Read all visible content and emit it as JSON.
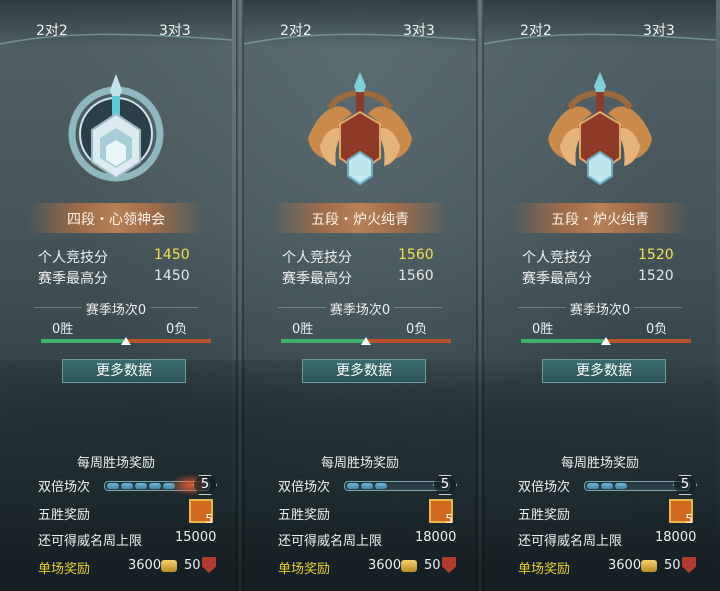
{
  "panels": [
    {
      "tabs": [
        "2对2",
        "3对3"
      ],
      "rank_name": "四段・心领神会",
      "emblem": "silver-blue-emblem",
      "personal_score_label": "个人竞技分",
      "personal_score": "1450",
      "season_high_label": "赛季最高分",
      "season_high": "1450",
      "season_matches": "赛季场次0",
      "wins": "0胜",
      "losses": "0负",
      "more_data": "更多数据",
      "weekly_reward": "每周胜场奖励",
      "double_label": "双倍场次",
      "double_count": "5",
      "five_win_label": "五胜奖励",
      "five_win_count": "5",
      "cap_label": "还可得威名周上限",
      "cap_value": "15000",
      "single_label": "单场奖励",
      "single_coins": "3600",
      "single_shield": "50"
    },
    {
      "tabs": [
        "2对2",
        "3对3"
      ],
      "rank_name": "五段・炉火纯青",
      "emblem": "bronze-winged-emblem",
      "personal_score_label": "个人竞技分",
      "personal_score": "1560",
      "season_high_label": "赛季最高分",
      "season_high": "1560",
      "season_matches": "赛季场次0",
      "wins": "0胜",
      "losses": "0负",
      "more_data": "更多数据",
      "weekly_reward": "每周胜场奖励",
      "double_label": "双倍场次",
      "double_count": "5",
      "five_win_label": "五胜奖励",
      "five_win_count": "5",
      "cap_label": "还可得威名周上限",
      "cap_value": "18000",
      "single_label": "单场奖励",
      "single_coins": "3600",
      "single_shield": "50"
    },
    {
      "tabs": [
        "2对2",
        "3对3"
      ],
      "rank_name": "五段・炉火纯青",
      "emblem": "bronze-winged-emblem",
      "personal_score_label": "个人竞技分",
      "personal_score": "1520",
      "season_high_label": "赛季最高分",
      "season_high": "1520",
      "season_matches": "赛季场次0",
      "wins": "0胜",
      "losses": "0负",
      "more_data": "更多数据",
      "weekly_reward": "每周胜场奖励",
      "double_label": "双倍场次",
      "double_count": "5",
      "five_win_label": "五胜奖励",
      "five_win_count": "5",
      "cap_label": "还可得威名周上限",
      "cap_value": "18000",
      "single_label": "单场奖励",
      "single_coins": "3600",
      "single_shield": "50"
    }
  ],
  "colors": {
    "score_highlight": "#f3e14a",
    "single_reward": "#e8d22d",
    "win_bar": "#3fb06a",
    "loss_bar": "#b9532f"
  }
}
